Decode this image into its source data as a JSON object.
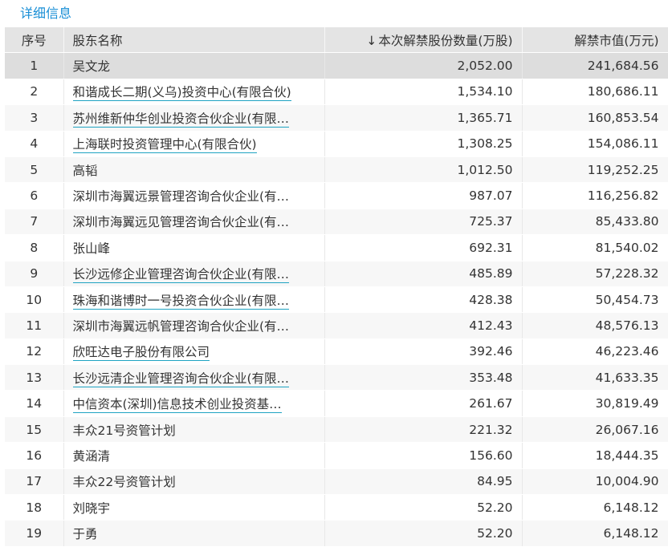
{
  "section": {
    "title": "详细信息"
  },
  "table": {
    "headers": {
      "index": "序号",
      "holder": "股东名称",
      "sort_arrow": "↓",
      "shares": "本次解禁股份数量(万股)",
      "value": "解禁市值(万元)"
    },
    "rows": [
      {
        "index": "1",
        "holder": "吴文龙",
        "shares": "2,052.00",
        "value": "241,684.56",
        "linked": false
      },
      {
        "index": "2",
        "holder": "和谐成长二期(义乌)投资中心(有限合伙)",
        "shares": "1,534.10",
        "value": "180,686.11",
        "linked": true
      },
      {
        "index": "3",
        "holder": "苏州维新仲华创业投资合伙企业(有限…",
        "shares": "1,365.71",
        "value": "160,853.54",
        "linked": true
      },
      {
        "index": "4",
        "holder": "上海联时投资管理中心(有限合伙)",
        "shares": "1,308.25",
        "value": "154,086.11",
        "linked": true
      },
      {
        "index": "5",
        "holder": "高韬",
        "shares": "1,012.50",
        "value": "119,252.25",
        "linked": false
      },
      {
        "index": "6",
        "holder": "深圳市海翼远景管理咨询合伙企业(有…",
        "shares": "987.07",
        "value": "116,256.82",
        "linked": false
      },
      {
        "index": "7",
        "holder": "深圳市海翼远见管理咨询合伙企业(有…",
        "shares": "725.37",
        "value": "85,433.80",
        "linked": false
      },
      {
        "index": "8",
        "holder": "张山峰",
        "shares": "692.31",
        "value": "81,540.02",
        "linked": false
      },
      {
        "index": "9",
        "holder": "长沙远修企业管理咨询合伙企业(有限…",
        "shares": "485.89",
        "value": "57,228.32",
        "linked": true
      },
      {
        "index": "10",
        "holder": "珠海和谐博时一号投资合伙企业(有限…",
        "shares": "428.38",
        "value": "50,454.73",
        "linked": true
      },
      {
        "index": "11",
        "holder": "深圳市海翼远帆管理咨询合伙企业(有…",
        "shares": "412.43",
        "value": "48,576.13",
        "linked": false
      },
      {
        "index": "12",
        "holder": "欣旺达电子股份有限公司",
        "shares": "392.46",
        "value": "46,223.46",
        "linked": true
      },
      {
        "index": "13",
        "holder": "长沙远清企业管理咨询合伙企业(有限…",
        "shares": "353.48",
        "value": "41,633.35",
        "linked": true
      },
      {
        "index": "14",
        "holder": "中信资本(深圳)信息技术创业投资基…",
        "shares": "261.67",
        "value": "30,819.49",
        "linked": true
      },
      {
        "index": "15",
        "holder": "丰众21号资管计划",
        "shares": "221.32",
        "value": "26,067.16",
        "linked": false
      },
      {
        "index": "16",
        "holder": "黄涵清",
        "shares": "156.60",
        "value": "18,444.35",
        "linked": false
      },
      {
        "index": "17",
        "holder": "丰众22号资管计划",
        "shares": "84.95",
        "value": "10,004.90",
        "linked": false
      },
      {
        "index": "18",
        "holder": "刘晓宇",
        "shares": "52.20",
        "value": "6,148.12",
        "linked": false
      },
      {
        "index": "19",
        "holder": "于勇",
        "shares": "52.20",
        "value": "6,148.12",
        "linked": false
      }
    ]
  },
  "colors": {
    "title": "#1a8fd6",
    "link_underline": "#1fa3c2",
    "header_bg": "#e4e4e4",
    "highlight_row": "#dddddd"
  }
}
